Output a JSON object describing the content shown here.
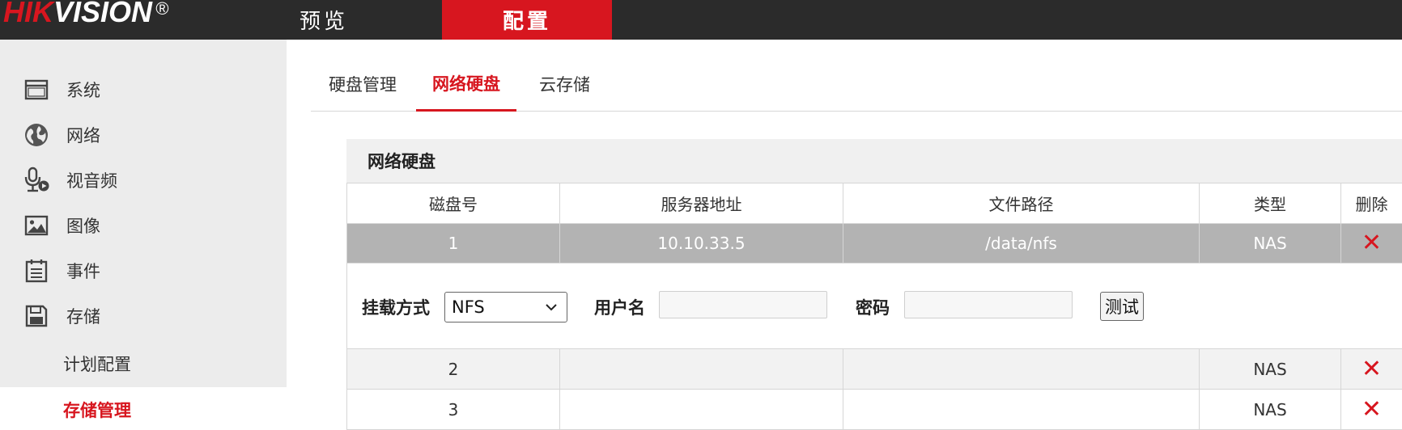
{
  "brand": {
    "part1": "HIK",
    "part2": "VISION",
    "mark": "®"
  },
  "top_nav": {
    "preview": "预览",
    "config": "配置"
  },
  "sidebar": {
    "items": [
      {
        "label": "系统",
        "icon": "window-icon"
      },
      {
        "label": "网络",
        "icon": "globe-icon"
      },
      {
        "label": "视音频",
        "icon": "microphone-icon"
      },
      {
        "label": "图像",
        "icon": "image-icon"
      },
      {
        "label": "事件",
        "icon": "calendar-list-icon"
      },
      {
        "label": "存储",
        "icon": "floppy-disk-icon"
      }
    ],
    "sub_items": [
      {
        "label": "计划配置"
      },
      {
        "label": "存储管理"
      }
    ]
  },
  "tabs": [
    {
      "label": "硬盘管理"
    },
    {
      "label": "网络硬盘"
    },
    {
      "label": "云存储"
    }
  ],
  "panel": {
    "title": "网络硬盘",
    "columns": [
      "磁盘号",
      "服务器地址",
      "文件路径",
      "类型",
      "删除"
    ],
    "rows": [
      {
        "disk": "1",
        "server": "10.10.33.5",
        "path": "/data/nfs",
        "type": "NAS"
      },
      {
        "disk": "2",
        "server": "",
        "path": "",
        "type": "NAS"
      },
      {
        "disk": "3",
        "server": "",
        "path": "",
        "type": "NAS"
      }
    ],
    "detail": {
      "mount_label": "挂载方式",
      "mount_value": "NFS",
      "username_label": "用户名",
      "username_value": "",
      "password_label": "密码",
      "password_value": "",
      "test_button": "测试"
    }
  },
  "colors": {
    "accent": "#d7161f",
    "topbar": "#2b2b2b",
    "sidebar_bg": "#ececec",
    "selected_row": "#b3b3b3"
  }
}
